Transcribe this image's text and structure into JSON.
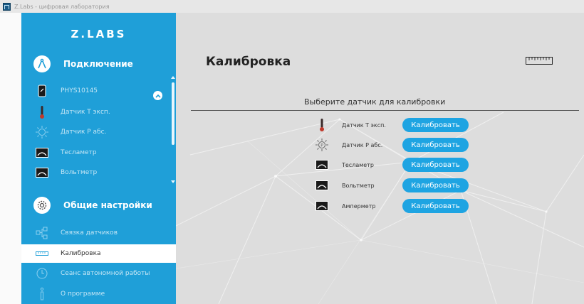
{
  "window": {
    "title": "Z.Labs - цифровая лаборатория"
  },
  "sidebar": {
    "logo": "Z.LABS",
    "connection_label": "Подключение",
    "sensors": [
      {
        "label": "PHYS10145",
        "icon": "phone-icon"
      },
      {
        "label": "Датчик Т эксп.",
        "icon": "thermometer-icon"
      },
      {
        "label": "Датчик Р абс.",
        "icon": "pressure-sensor-icon"
      },
      {
        "label": "Тесламетр",
        "icon": "meter-icon"
      },
      {
        "label": "Вольтметр",
        "icon": "meter-icon"
      }
    ],
    "settings_label": "Общие настройки",
    "settings_items": [
      {
        "label": "Связка датчиков",
        "icon": "sensor-link-icon"
      },
      {
        "label": "Калибровка",
        "icon": "ruler-icon",
        "selected": true
      },
      {
        "label": "Сеанс автономной работы",
        "icon": "clock-icon"
      },
      {
        "label": "О программе",
        "icon": "info-icon"
      }
    ]
  },
  "main": {
    "title": "Калибровка",
    "subtitle": "Выберите датчик для калибровки",
    "rows": [
      {
        "name": "Датчик Т эксп.",
        "button": "Калибровать",
        "icon": "thermometer-icon"
      },
      {
        "name": "Датчик Р абс.",
        "button": "Калибровать",
        "icon": "pressure-sensor-icon"
      },
      {
        "name": "Тесламетр",
        "button": "Калибровать",
        "icon": "meter-icon"
      },
      {
        "name": "Вольтметр",
        "button": "Калибровать",
        "icon": "meter-icon"
      },
      {
        "name": "Амперметр",
        "button": "Калибровать",
        "icon": "meter-icon"
      }
    ]
  },
  "colors": {
    "sidebar_bg": "#1f9fd8",
    "accent_button": "#1ea4e2",
    "main_bg": "#dddddd"
  }
}
